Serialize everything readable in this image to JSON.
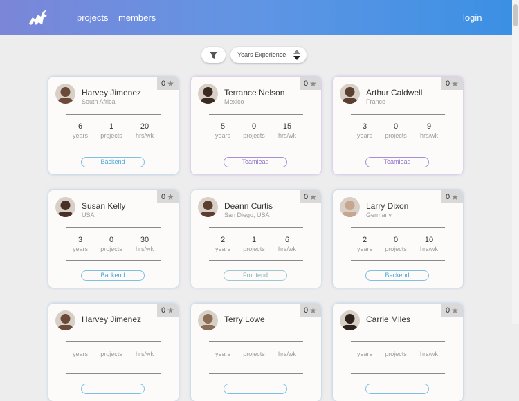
{
  "nav": {
    "links": [
      "projects",
      "members"
    ],
    "login": "login"
  },
  "toolbar": {
    "sort_label": "Years Experience"
  },
  "colors": {
    "header_gradient": [
      "#7b86d8",
      "#3b90e4"
    ],
    "backend": "#4aa6d8",
    "teamlead": "#8a6fc8",
    "frontend": "#8ab0b8",
    "background": "#eeedee"
  },
  "stat_labels": {
    "years": "years",
    "projects": "projects",
    "hours": "hrs/wk"
  },
  "members": [
    {
      "name": "Harvey Jimenez",
      "location": "South Africa",
      "stars": "0",
      "years": "6",
      "projects": "1",
      "hours": "20",
      "role": "Backend"
    },
    {
      "name": "Terrance Nelson",
      "location": "Mexico",
      "stars": "0",
      "years": "5",
      "projects": "0",
      "hours": "15",
      "role": "Teamlead"
    },
    {
      "name": "Arthur Caldwell",
      "location": "France",
      "stars": "0",
      "years": "3",
      "projects": "0",
      "hours": "9",
      "role": "Teamlead"
    },
    {
      "name": "Susan Kelly",
      "location": "USA",
      "stars": "0",
      "years": "3",
      "projects": "0",
      "hours": "30",
      "role": "Backend"
    },
    {
      "name": "Deann Curtis",
      "location": "San Diego, USA",
      "stars": "0",
      "years": "2",
      "projects": "1",
      "hours": "6",
      "role": "Frontend"
    },
    {
      "name": "Larry Dixon",
      "location": "Germany",
      "stars": "0",
      "years": "2",
      "projects": "0",
      "hours": "10",
      "role": "Backend"
    },
    {
      "name": "Harvey Jimenez",
      "location": "",
      "stars": "0",
      "years": "",
      "projects": "",
      "hours": "",
      "role": ""
    },
    {
      "name": "Terry Lowe",
      "location": "",
      "stars": "0",
      "years": "",
      "projects": "",
      "hours": "",
      "role": ""
    },
    {
      "name": "Carrie Miles",
      "location": "",
      "stars": "0",
      "years": "",
      "projects": "",
      "hours": "",
      "role": ""
    }
  ]
}
